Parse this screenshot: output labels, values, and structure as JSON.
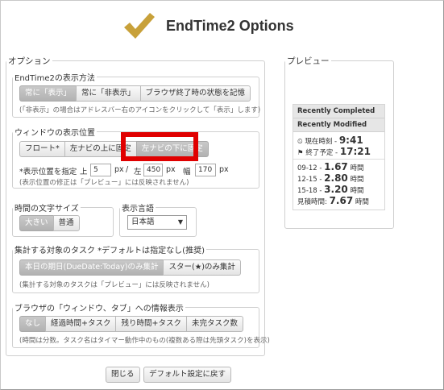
{
  "app": {
    "title": "EndTime2 Options"
  },
  "options_legend": "オプション",
  "display_method": {
    "legend": "EndTime2の表示方法",
    "buttons": [
      "常に「表示」",
      "常に「非表示」",
      "ブラウザ終了時の状態を記憶"
    ],
    "selected": 0,
    "note": "(「非表示」の場合はアドレスバー右のアイコンをクリックして「表示」します)"
  },
  "window_position": {
    "legend": "ウィンドウの表示位置",
    "buttons": [
      "フロート*",
      "左ナビの上に固定",
      "左ナビの下に固定"
    ],
    "selected": 2,
    "specify_label": "*表示位置を指定",
    "top_label": "上",
    "top_value": "5",
    "left_label": "左",
    "left_value": "450",
    "width_label": "幅",
    "width_value": "170",
    "unit_px": "px",
    "slash": "/",
    "note": "(表示位置の修正は「プレビュー」には反映されません)"
  },
  "font_size": {
    "legend": "時間の文字サイズ",
    "buttons": [
      "大きい",
      "普通"
    ],
    "selected": 0
  },
  "language": {
    "legend": "表示言語",
    "selected": "日本語",
    "arrow": "▼"
  },
  "tasks": {
    "legend": "集計する対象のタスク *デフォルトは指定なし(推奨)",
    "buttons": [
      "本日の期日(DueDate:Today)のみ集計",
      "スター(★)のみ集計"
    ],
    "selected": 0,
    "note": "(集計する対象のタスクは「プレビュー」には反映されません)"
  },
  "info": {
    "legend": "ブラウザの「ウィンドウ、タブ」への情報表示",
    "buttons": [
      "なし",
      "経過時間+タスク",
      "残り時間+タスク",
      "未完タスク数"
    ],
    "selected": 0,
    "note": "(時間は分数。タスク名はタイマー動作中のもの(複数ある際は先頭タスク)を表示)"
  },
  "footer": {
    "close": "閉じる",
    "reset": "デフォルト設定に戻す"
  },
  "preview": {
    "legend": "プレビュー",
    "recently_completed": "Recently Completed",
    "recently_modified": "Recently Modified",
    "now_label": "現在時刻 - ",
    "now_value": "9:41",
    "end_label": "終了予定 - ",
    "end_value": "17:21",
    "rows": [
      {
        "label": "09-12 - ",
        "value": "1.67",
        "unit": " 時間"
      },
      {
        "label": "12-15 - ",
        "value": "2.80",
        "unit": " 時間"
      },
      {
        "label": "15-18 - ",
        "value": "3.20",
        "unit": " 時間"
      }
    ],
    "total_label": "見積時間: ",
    "total_value": "7.67",
    "total_unit": " 時間"
  },
  "colors": {
    "selected_bg": "#b8b8b8",
    "highlight_border": "#e00000",
    "logo": "#c8a13a"
  }
}
